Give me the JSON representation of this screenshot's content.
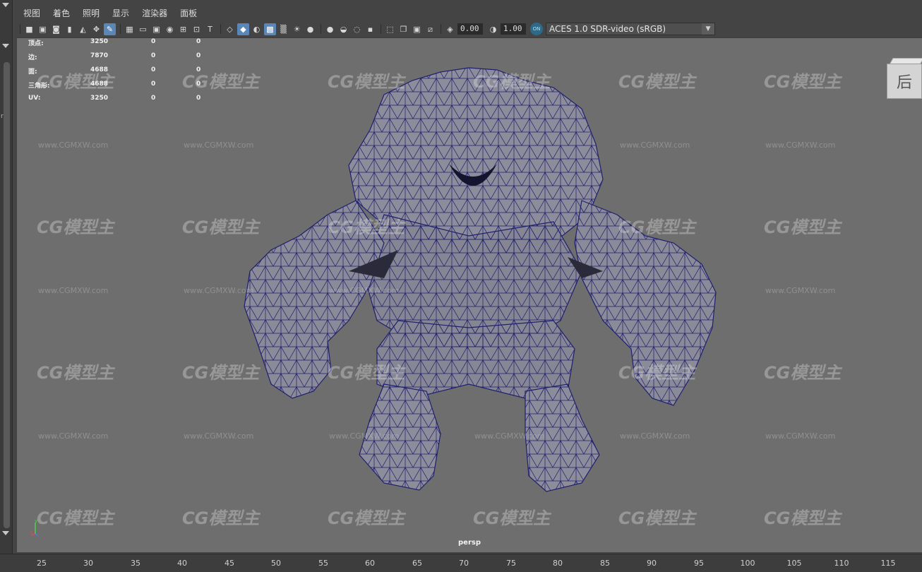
{
  "menubar": {
    "items": [
      "视图",
      "着色",
      "照明",
      "显示",
      "渲染器",
      "面板"
    ]
  },
  "toolbar": {
    "icons_group1": [
      "camera-icon",
      "camera-attributes-icon",
      "camera-bookmark-icon",
      "bookmark-icon",
      "image-plane-icon",
      "2d-pan-zoom-icon",
      "grease-pencil-icon"
    ],
    "icons_group2": [
      "grid-icon",
      "film-gate-icon",
      "resolution-gate-icon",
      "gate-mask-icon",
      "field-chart-icon",
      "safe-action-icon",
      "safe-title-icon"
    ],
    "icons_group3": [
      "wireframe-icon",
      "smooth-shade-icon",
      "default-material-icon",
      "wireframe-on-shaded-icon",
      "textured-icon",
      "lights-icon",
      "shadows-icon"
    ],
    "icons_group4": [
      "screen-space-ao-icon",
      "motion-blur-icon",
      "anti-aliasing-icon",
      "depth-of-field-icon"
    ],
    "icons_group5": [
      "isolate-select-icon",
      "xray-icon",
      "xray-active-components-icon",
      "xray-joints-icon",
      "backface-culling-icon"
    ],
    "exposure_value": "0.00",
    "gamma_value": "1.00",
    "colorspace_badge": "ON",
    "colorspace": "ACES 1.0 SDR-video (sRGB)"
  },
  "hud": {
    "rows": [
      {
        "label": "顶点:",
        "v1": "3250",
        "v2": "0",
        "v3": "0"
      },
      {
        "label": "边:",
        "v1": "7870",
        "v2": "0",
        "v3": "0"
      },
      {
        "label": "面:",
        "v1": "4688",
        "v2": "0",
        "v3": "0"
      },
      {
        "label": "三角形:",
        "v1": "4688",
        "v2": "0",
        "v3": "0"
      },
      {
        "label": "UV:",
        "v1": "3250",
        "v2": "0",
        "v3": "0"
      }
    ]
  },
  "viewcube": {
    "face_label": "后"
  },
  "viewport": {
    "camera": "persp",
    "axis_x": "x",
    "axis_y": "y",
    "watermark_logo": "CG模型主",
    "watermark_url": "www.CGMXW.com"
  },
  "left_strip": {
    "letter": "r"
  },
  "ruler": {
    "ticks": [
      "25",
      "30",
      "35",
      "40",
      "45",
      "50",
      "55",
      "60",
      "65",
      "70",
      "75",
      "80",
      "85",
      "90",
      "95",
      "100",
      "105",
      "110",
      "115"
    ]
  },
  "colors": {
    "viewport_bg": "#6e6e6e",
    "wire": "#1f1f6e",
    "mesh": "#8c8c9a",
    "active_icon": "#5b87b8"
  }
}
